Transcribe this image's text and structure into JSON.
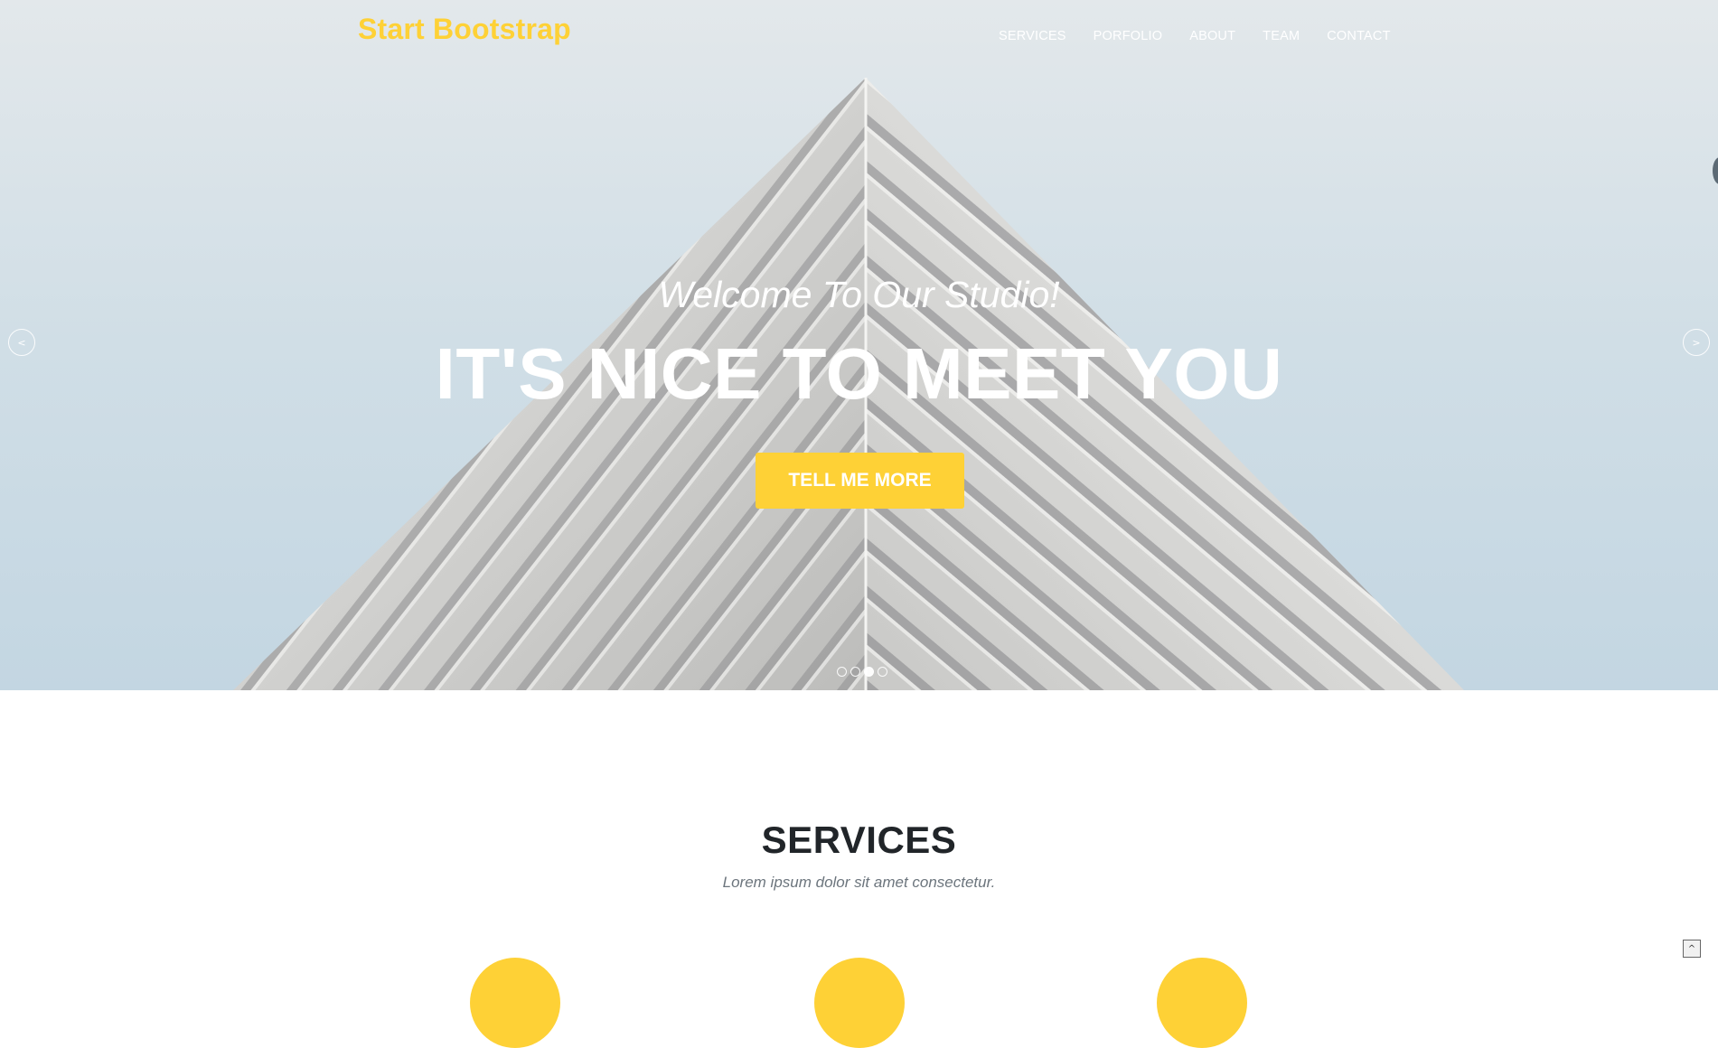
{
  "navbar": {
    "brand": "Start Bootstrap",
    "items": [
      {
        "label": "SERVICES"
      },
      {
        "label": "PORFOLIO"
      },
      {
        "label": "ABOUT"
      },
      {
        "label": "TEAM"
      },
      {
        "label": "CONTACT"
      }
    ]
  },
  "hero": {
    "subtitle": "Welcome To Our Studio!",
    "title": "IT'S NICE TO MEET YOU",
    "cta_label": "TELL ME MORE",
    "prev_arrow": "<",
    "next_arrow": ">",
    "slides_total": 4,
    "active_slide": 3
  },
  "services": {
    "heading": "SERVICES",
    "subheading": "Lorem ipsum dolor sit amet consectetur."
  },
  "scroll_top_label": "^",
  "colors": {
    "accent": "#fed136",
    "heading": "#212529",
    "muted": "#6c757d"
  }
}
